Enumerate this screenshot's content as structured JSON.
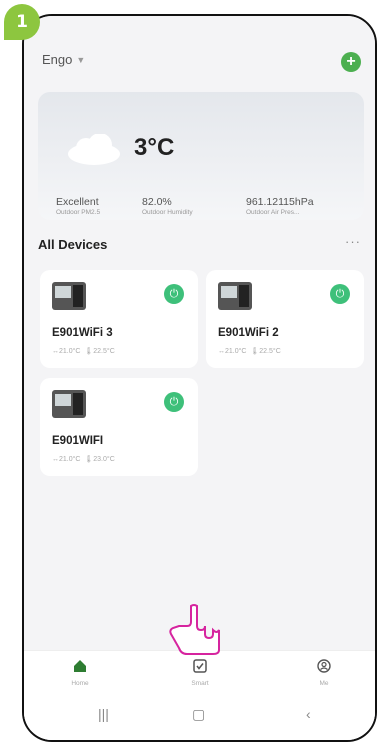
{
  "step": {
    "number": "1"
  },
  "header": {
    "home_name": "Engo",
    "add_icon": "plus-circle-icon",
    "accent": "#4caf50"
  },
  "weather": {
    "temperature": "3°C",
    "icon": "cloud-icon",
    "stats": [
      {
        "value": "Excellent",
        "label": "Outdoor PM2.5"
      },
      {
        "value": "82.0%",
        "label": "Outdoor Humidity"
      },
      {
        "value": "961.12115hPa",
        "label": "Outdoor Air Pres..."
      }
    ]
  },
  "devices_section": {
    "title": "All Devices",
    "more": "···"
  },
  "devices": [
    {
      "name": "E901WiFi 3",
      "room_temp": "21.0°C",
      "set_temp": "22.5°C"
    },
    {
      "name": "E901WiFi 2",
      "room_temp": "21.0°C",
      "set_temp": "22.5°C"
    },
    {
      "name": "E901WIFI",
      "room_temp": "21.0°C",
      "set_temp": "23.0°C"
    }
  ],
  "tabs": [
    {
      "label": "Home",
      "icon": "home-icon",
      "active": true
    },
    {
      "label": "Smart",
      "icon": "checkbox-icon",
      "active": false
    },
    {
      "label": "Me",
      "icon": "user-circle-icon",
      "active": false
    }
  ],
  "colors": {
    "power_on": "#3ec07a",
    "step_badge": "#8dc63f",
    "hand_pointer": "#d6249f",
    "active_tab": "#2e7d32"
  }
}
